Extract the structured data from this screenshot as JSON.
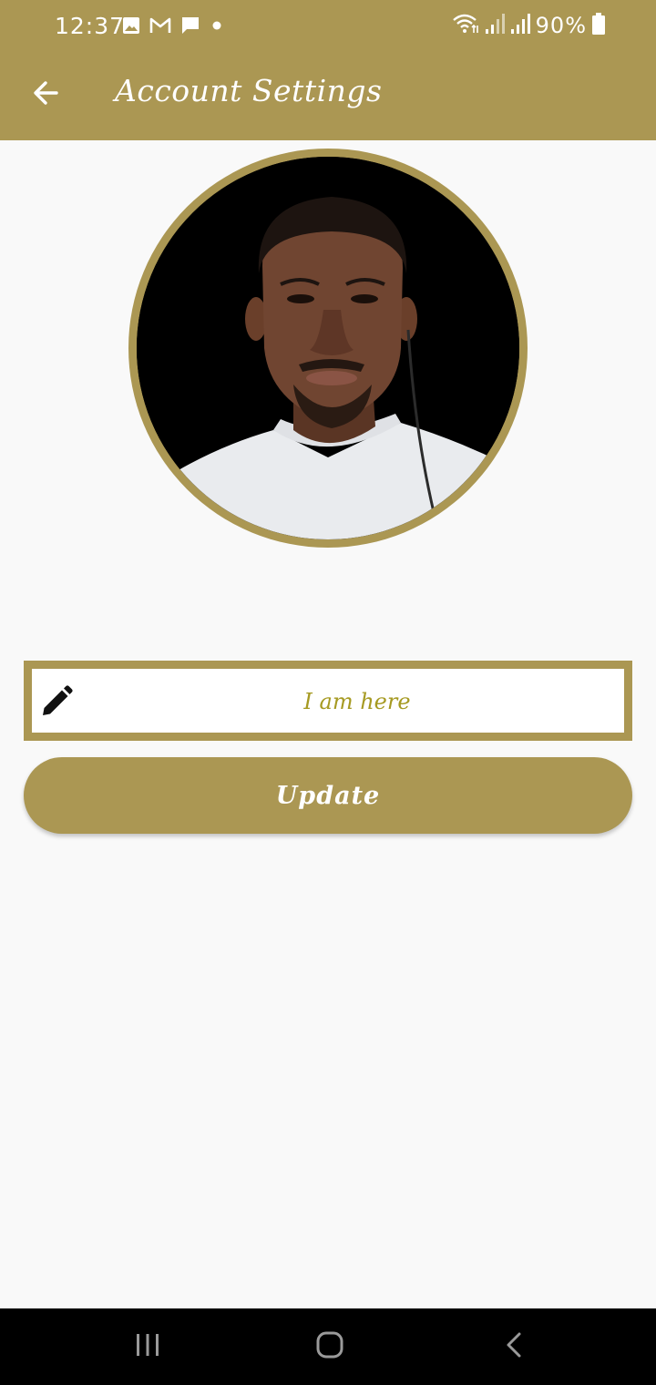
{
  "status_bar": {
    "time": "12:37",
    "notification_icons": [
      "image-icon",
      "gmail-icon",
      "message-icon",
      "dot-icon"
    ],
    "system_icons": [
      "wifi-icon",
      "signal-icon",
      "signal-icon"
    ],
    "battery": "90%"
  },
  "app_bar": {
    "title": "Account Settings",
    "back_icon": "arrow-left-icon"
  },
  "profile": {
    "avatar_icon": "profile-photo"
  },
  "status_field": {
    "value": "I am here",
    "icon": "pencil-icon"
  },
  "actions": {
    "update_label": "Update"
  },
  "nav_bar": {
    "icons": [
      "recent-apps-icon",
      "home-icon",
      "back-icon"
    ]
  },
  "colors": {
    "primary": "#ab9753",
    "input_text": "#a69a22",
    "background": "#f9f9f9",
    "nav_background": "#000000"
  }
}
